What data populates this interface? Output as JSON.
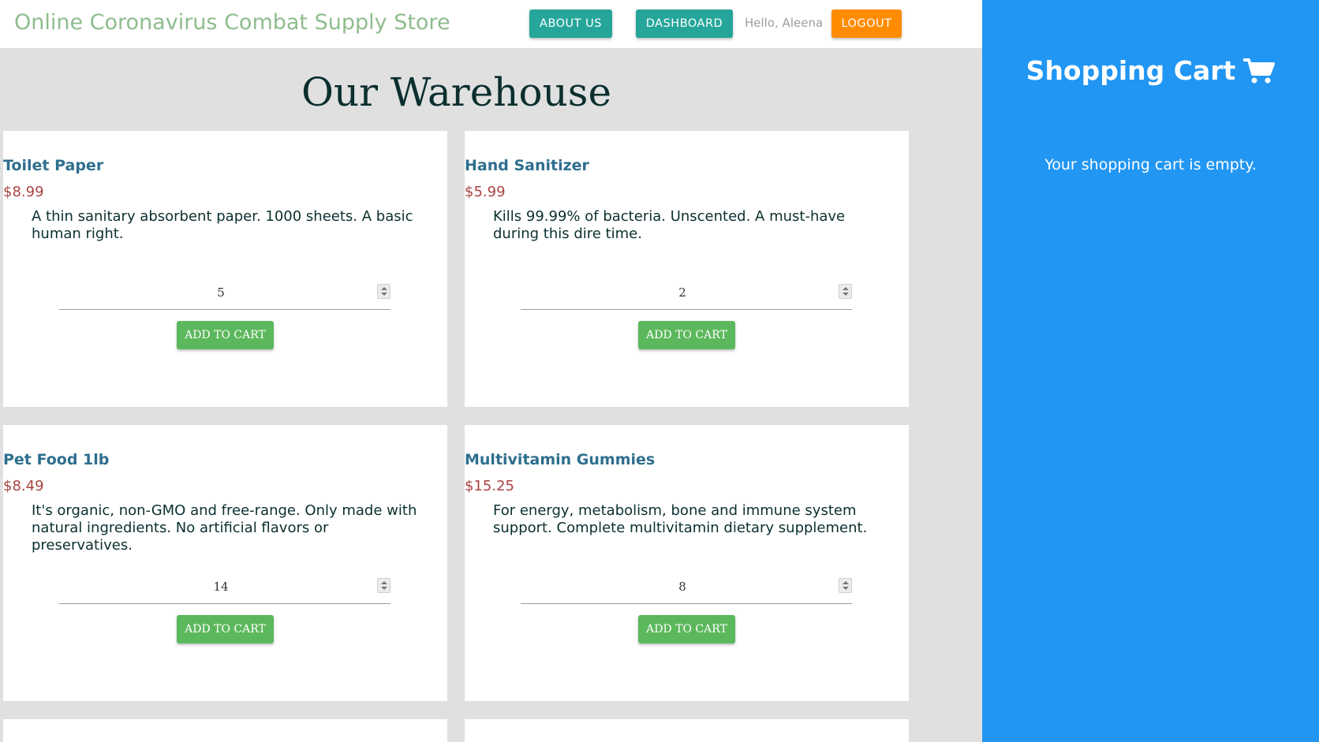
{
  "header": {
    "brand": "Online Coronavirus Combat Supply Store",
    "about_label": "ABOUT US",
    "dashboard_label": "DASHBOARD",
    "greeting": "Hello, Aleena",
    "logout_label": "LOGOUT"
  },
  "main": {
    "title": "Our Warehouse",
    "products": [
      {
        "name": "Toilet Paper",
        "price": "$8.99",
        "description": "A thin sanitary absorbent paper. 1000 sheets. A basic human right.",
        "quantity": "5",
        "button": "ADD TO CART"
      },
      {
        "name": "Hand Sanitizer",
        "price": "$5.99",
        "description": "Kills 99.99% of bacteria. Unscented. A must-have during this dire time.",
        "quantity": "2",
        "button": "ADD TO CART"
      },
      {
        "name": "Pet Food 1lb",
        "price": "$8.49",
        "description": "It's organic, non-GMO and free-range. Only made with natural ingredients. No artificial flavors or preservatives.",
        "quantity": "14",
        "button": "ADD TO CART"
      },
      {
        "name": "Multivitamin Gummies",
        "price": "$15.25",
        "description": "For energy, metabolism, bone and immune system support. Complete multivitamin dietary supplement.",
        "quantity": "8",
        "button": "ADD TO CART"
      }
    ]
  },
  "cart": {
    "title": "Shopping Cart",
    "icon": "shopping-cart-icon",
    "empty_message": "Your shopping cart is empty."
  },
  "colors": {
    "brand": "#8fbc8f",
    "nav_button": "#26a69a",
    "logout_button": "#ff8c00",
    "add_button": "#5cb85c",
    "price": "#a94442",
    "product_title": "#2e6e8e",
    "cart_panel": "#2196f3"
  }
}
